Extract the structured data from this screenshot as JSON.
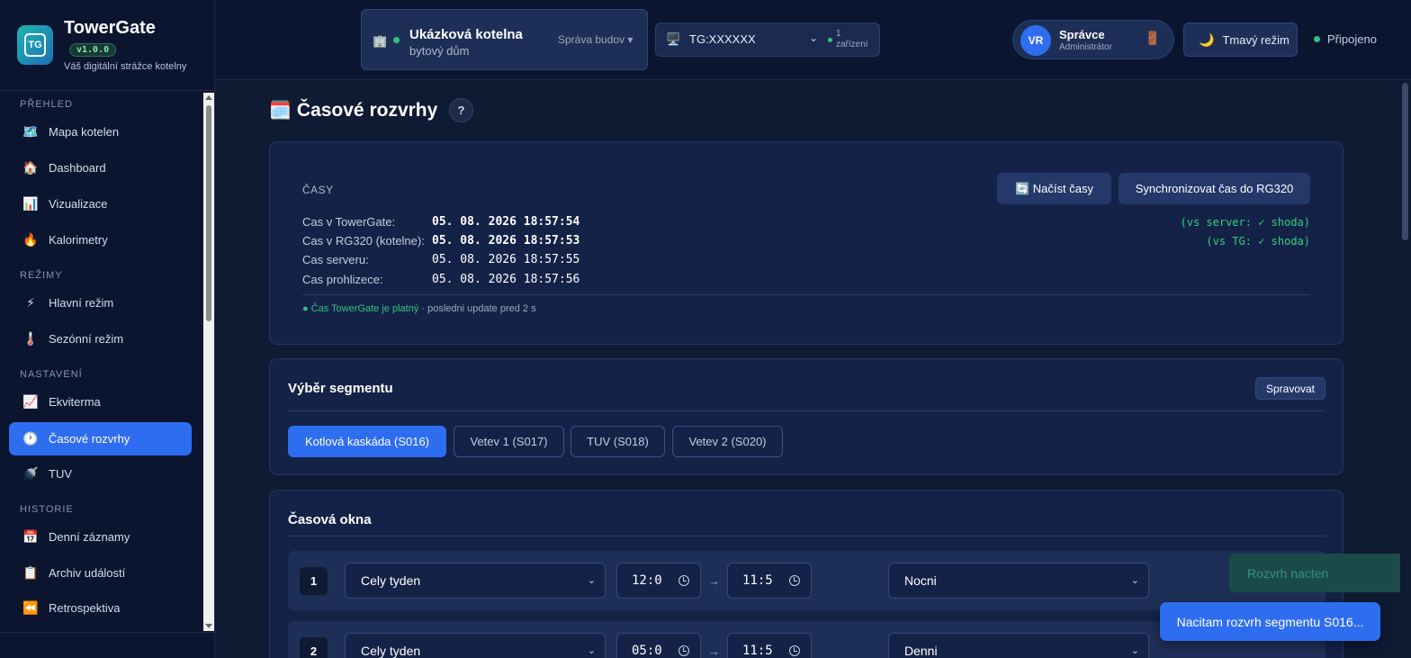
{
  "brand": {
    "name": "TowerGate",
    "version": "v1.0.0",
    "tagline": "Váš digitální strážce kotelny",
    "logo_icon": "tg-hex-logo"
  },
  "sidebar": {
    "sections": [
      {
        "title": "PŘEHLED",
        "items": [
          {
            "label": "Mapa kotelen",
            "icon": "🗺️"
          },
          {
            "label": "Dashboard",
            "icon": "🏠"
          },
          {
            "label": "Vizualizace",
            "icon": "📊"
          },
          {
            "label": "Kalorimetry",
            "icon": "🔥"
          }
        ]
      },
      {
        "title": "REŽIMY",
        "items": [
          {
            "label": "Hlavní režim",
            "icon": "⚡"
          },
          {
            "label": "Sezónní režim",
            "icon": "🌡️"
          }
        ]
      },
      {
        "title": "NASTAVENÍ",
        "items": [
          {
            "label": "Ekviterma",
            "icon": "📈"
          },
          {
            "label": "Časové rozvrhy",
            "icon": "🕐",
            "active": true
          },
          {
            "label": "TUV",
            "icon": "🚿"
          }
        ]
      },
      {
        "title": "HISTORIE",
        "items": [
          {
            "label": "Denní záznamy",
            "icon": "📅"
          },
          {
            "label": "Archiv událostí",
            "icon": "📋"
          },
          {
            "label": "Retrospektiva",
            "icon": "⏪"
          }
        ]
      }
    ]
  },
  "header": {
    "building": {
      "name": "Ukázková kotelna",
      "type": "bytový dům",
      "manage_label": "Správa budov ▾",
      "icon": "🏢"
    },
    "device": {
      "selected": "TG:XXXXXX",
      "count_num": "1",
      "count_label": "zařízení",
      "icon": "🖥️"
    },
    "user": {
      "initials": "VR",
      "name": "Správce",
      "role": "Administrátor",
      "logout_icon": "🚪"
    },
    "theme_label": "Tmavý režim",
    "theme_icon": "🌙",
    "status": "Připojeno"
  },
  "page": {
    "title": "Časové rozvrhy",
    "title_icon": "🗓️",
    "help": "?"
  },
  "times": {
    "label": "ČASY",
    "load_button": "🔄 Načíst časy",
    "sync_button": "Synchronizovat čas do RG320",
    "rows": [
      {
        "label": "Cas v TowerGate:",
        "value": "05. 08. 2026 18:57:54",
        "compare": "(vs server: ✓ shoda)"
      },
      {
        "label": "Cas v RG320 (kotelne):",
        "value": "05. 08. 2026 18:57:53",
        "compare": "(vs TG: ✓ shoda)"
      },
      {
        "label": "Cas serveru:",
        "value": "05. 08. 2026 18:57:55"
      },
      {
        "label": "Cas prohlizece:",
        "value": "05. 08. 2026 18:57:56"
      }
    ],
    "valid_text": "● Čas TowerGate je platný",
    "update_text": " · posledni update pred 2 s"
  },
  "segments": {
    "title": "Výběr segmentu",
    "manage": "Spravovat",
    "items": [
      {
        "label": "Kotlová kaskáda (S016)",
        "active": true
      },
      {
        "label": "Vetev 1 (S017)"
      },
      {
        "label": "TUV (S018)"
      },
      {
        "label": "Vetev 2 (S020)"
      }
    ]
  },
  "windows": {
    "title": "Časová okna",
    "rows": [
      {
        "num": "1",
        "days": "Cely tyden",
        "from": "12:0",
        "to": "11:5",
        "mode": "Nocni"
      },
      {
        "num": "2",
        "days": "Cely tyden",
        "from": "05:0",
        "to": "11:5",
        "mode": "Denni"
      }
    ],
    "arrow": "→"
  },
  "toasts": {
    "loaded": "Rozvrh nacten",
    "loading": "Nacitam rozvrh segmentu S016..."
  }
}
